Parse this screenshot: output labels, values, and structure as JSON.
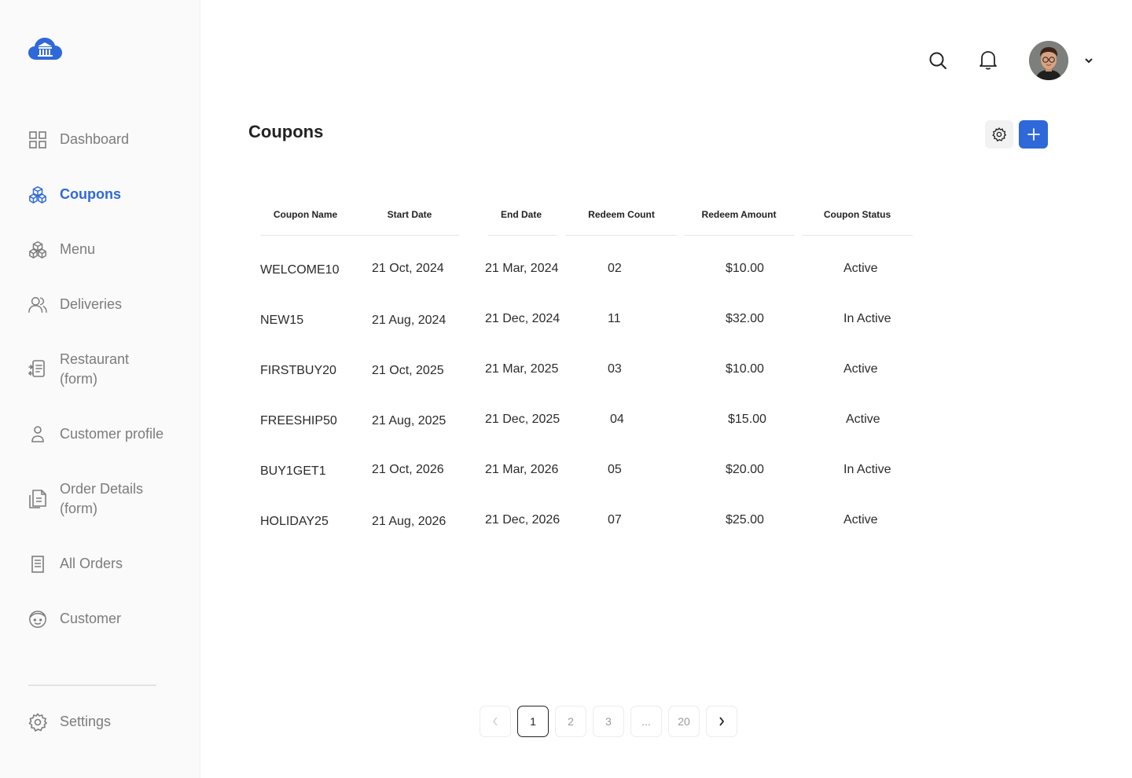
{
  "sidebar": {
    "items": [
      {
        "label": "Dashboard",
        "icon": "grid-icon"
      },
      {
        "label": "Coupons",
        "icon": "cubes-icon",
        "active": true
      },
      {
        "label": "Menu",
        "icon": "cubes-icon"
      },
      {
        "label": "Deliveries",
        "icon": "users-icon"
      },
      {
        "label": "Restaurant (form)",
        "icon": "form-transfer-icon"
      },
      {
        "label": "Customer profile",
        "icon": "person-icon"
      },
      {
        "label": "Order Details (form)",
        "icon": "document-icon"
      },
      {
        "label": "All Orders",
        "icon": "receipt-icon"
      },
      {
        "label": "Customer",
        "icon": "face-icon"
      }
    ],
    "settings_label": "Settings"
  },
  "header": {
    "icons": [
      "search-icon",
      "bell-icon",
      "avatar",
      "chevron-down-icon"
    ]
  },
  "page": {
    "title": "Coupons"
  },
  "table": {
    "columns": [
      "Coupon Name",
      "Start Date",
      "End Date",
      "Redeem Count",
      "Redeem Amount",
      "Coupon Status"
    ],
    "rows": [
      [
        "WELCOME10",
        "21 Oct, 2024",
        "21 Mar, 2024",
        "02",
        "$10.00",
        "Active"
      ],
      [
        "NEW15",
        "21 Aug, 2024",
        "21 Dec, 2024",
        "11",
        "$32.00",
        "In Active"
      ],
      [
        "FIRSTBUY20",
        "21 Oct, 2025",
        "21 Mar, 2025",
        "03",
        "$10.00",
        "Active"
      ],
      [
        "FREESHIP50",
        "21 Aug, 2025",
        "21 Dec, 2025",
        "04",
        "$15.00",
        "Active"
      ],
      [
        "BUY1GET1",
        "21 Oct, 2026",
        "21 Mar, 2026",
        "05",
        "$20.00",
        "In Active"
      ],
      [
        "HOLIDAY25",
        "21 Aug, 2026",
        "21 Dec, 2026",
        "07",
        "$25.00",
        "Active"
      ]
    ]
  },
  "pagination": {
    "pages": [
      "1",
      "2",
      "3",
      "...",
      "20"
    ],
    "current": "1"
  },
  "colors": {
    "accent": "#2f68d8",
    "muted": "#7c7c7c"
  }
}
